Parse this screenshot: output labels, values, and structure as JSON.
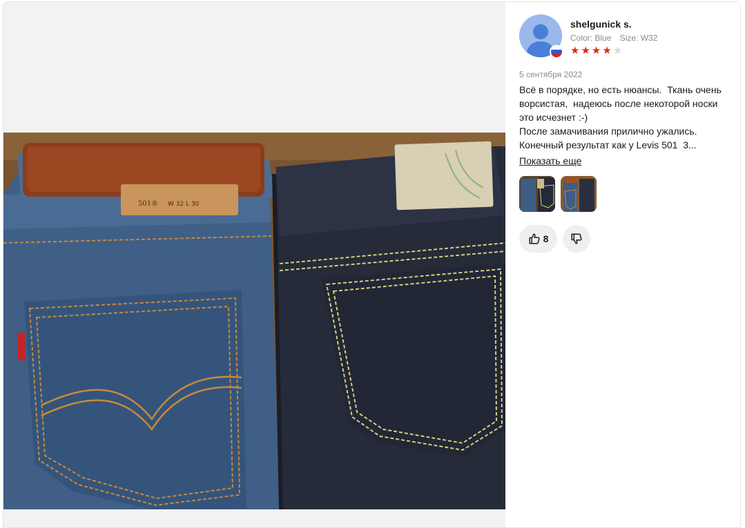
{
  "review": {
    "author": {
      "name": "shelgunick s.",
      "avatar_icon": "user-avatar-icon",
      "country_flag": "russia-flag-icon"
    },
    "attributes": {
      "color": "Color: Blue",
      "size": "Size: W32"
    },
    "rating": {
      "value": 4,
      "max": 5,
      "star_color": "#d92e1a",
      "empty_star_color": "#d9d9d9"
    },
    "date": "5 сентября 2022",
    "text": "Всё в порядке, но есть нюансы.  Ткань очень ворсистая,  надеюсь после некоторой носки это исчезнет :-)\nПосле замачивания прилично ужались.  Конечный результат как у Levis 501  3...",
    "show_more_label": "Показать еще",
    "photos": [
      {
        "icon": "jeans-photo-thumbnail"
      },
      {
        "icon": "jeans-photo-thumbnail"
      }
    ],
    "votes": {
      "like_count": "8",
      "like_icon": "thumbs-up-icon",
      "dislike_icon": "thumbs-down-icon"
    }
  },
  "main_photo": {
    "label_patch_1": "501®",
    "label_patch_size": "W 32  L 30"
  }
}
